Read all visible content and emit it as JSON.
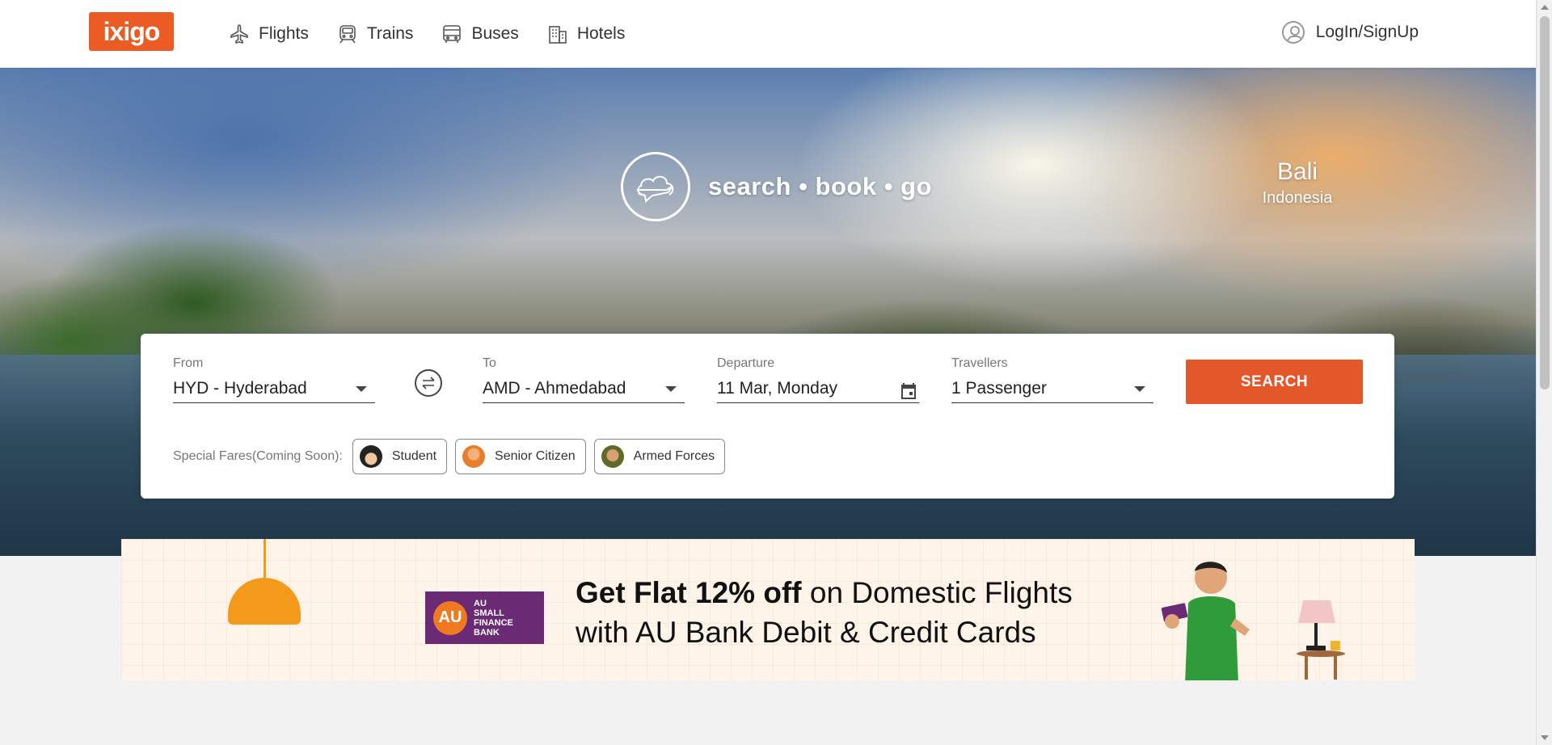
{
  "header": {
    "logo_text": "ixigo",
    "nav": [
      {
        "label": "Flights",
        "icon": "plane-icon"
      },
      {
        "label": "Trains",
        "icon": "train-icon"
      },
      {
        "label": "Buses",
        "icon": "bus-icon"
      },
      {
        "label": "Hotels",
        "icon": "hotel-icon"
      }
    ],
    "login_label": "LogIn/SignUp"
  },
  "hero": {
    "tagline": "search • book • go",
    "place_name": "Bali",
    "place_country": "Indonesia"
  },
  "search": {
    "from_label": "From",
    "from_value": "HYD - Hyderabad",
    "to_label": "To",
    "to_value": "AMD - Ahmedabad",
    "departure_label": "Departure",
    "departure_value": "11 Mar, Monday",
    "travellers_label": "Travellers",
    "travellers_value": "1 Passenger",
    "search_button": "SEARCH",
    "special_fares_label": "Special Fares(Coming Soon):",
    "special_fares": [
      {
        "label": "Student"
      },
      {
        "label": "Senior Citizen"
      },
      {
        "label": "Armed Forces"
      }
    ]
  },
  "banner": {
    "bank_badge": "AU",
    "bank_name_lines": [
      "AU",
      "SMALL",
      "FINANCE",
      "BANK"
    ],
    "headline_bold": "Get Flat 12% off",
    "headline_rest": " on Domestic Flights",
    "subline": "with AU Bank Debit & Credit Cards"
  },
  "colors": {
    "brand": "#ec5b24",
    "search_button": "#e4572a",
    "bank_purple": "#6a2b74"
  }
}
